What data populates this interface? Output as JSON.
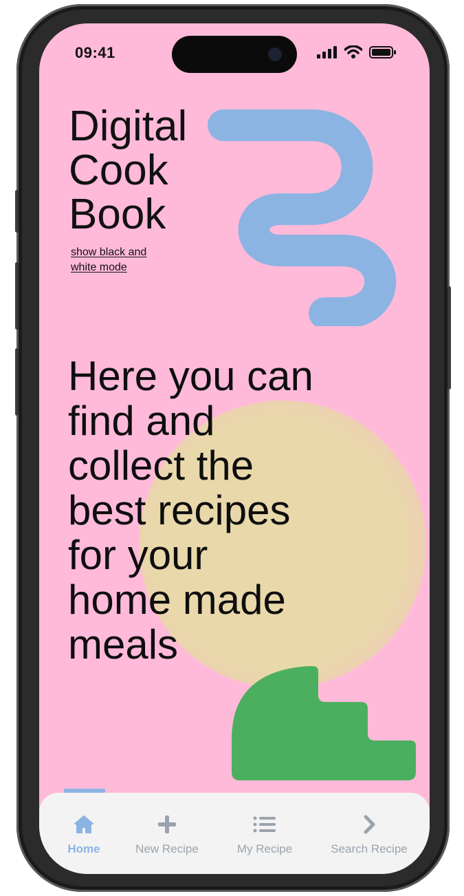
{
  "status_bar": {
    "time": "09:41"
  },
  "title_lines": [
    "Digital",
    "Cook",
    "Book"
  ],
  "mode_toggle_label": "show black and white mode",
  "hero_lines": [
    "Here you can",
    "find and",
    "collect the",
    "best recipes",
    "for your",
    "home made",
    "meals"
  ],
  "tabs": [
    {
      "label": "Home",
      "icon": "home-icon",
      "active": true
    },
    {
      "label": "New Recipe",
      "icon": "plus-icon",
      "active": false
    },
    {
      "label": "My Recipe",
      "icon": "list-icon",
      "active": false
    },
    {
      "label": "Search Recipe",
      "icon": "chevron-right-icon",
      "active": false
    }
  ],
  "colors": {
    "background": "#ffbad9",
    "snake": "#8cb4e3",
    "sun": "#e9d8aa",
    "steps": "#4caf60",
    "active_tab": "#8cb4e3",
    "inactive_tab": "#9aa3ad",
    "tabbar": "#f3f3f3"
  }
}
